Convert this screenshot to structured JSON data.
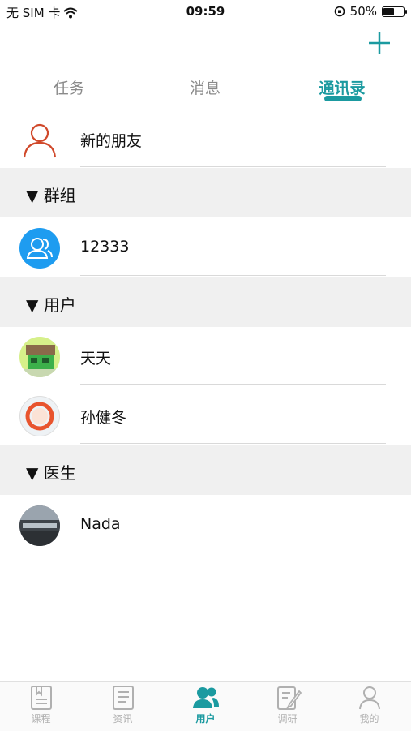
{
  "status_bar": {
    "carrier": "无 SIM 卡",
    "time": "09:59",
    "battery": "50%"
  },
  "tabs": [
    {
      "label": "任务",
      "active": false
    },
    {
      "label": "消息",
      "active": false
    },
    {
      "label": "通讯录",
      "active": true
    }
  ],
  "new_friends": {
    "label": "新的朋友"
  },
  "sections": {
    "groups": {
      "label": "▼ 群组"
    },
    "users": {
      "label": "▼ 用户"
    },
    "doctors": {
      "label": "▼ 医生"
    }
  },
  "groups": [
    {
      "name": "12333"
    }
  ],
  "users": [
    {
      "name": "天天"
    },
    {
      "name": "孙健冬"
    }
  ],
  "doctors": [
    {
      "name": "Nada"
    }
  ],
  "tabbar": [
    {
      "label": "课程",
      "icon": "course-icon",
      "active": false
    },
    {
      "label": "资讯",
      "icon": "news-icon",
      "active": false
    },
    {
      "label": "用户",
      "icon": "users-icon",
      "active": true
    },
    {
      "label": "调研",
      "icon": "survey-icon",
      "active": false
    },
    {
      "label": "我的",
      "icon": "profile-icon",
      "active": false
    }
  ],
  "colors": {
    "accent": "#1b9aa0",
    "new_friend_icon": "#d0482a",
    "group_avatar": "#1e9cf0",
    "section_bg": "#f0f0f0"
  }
}
